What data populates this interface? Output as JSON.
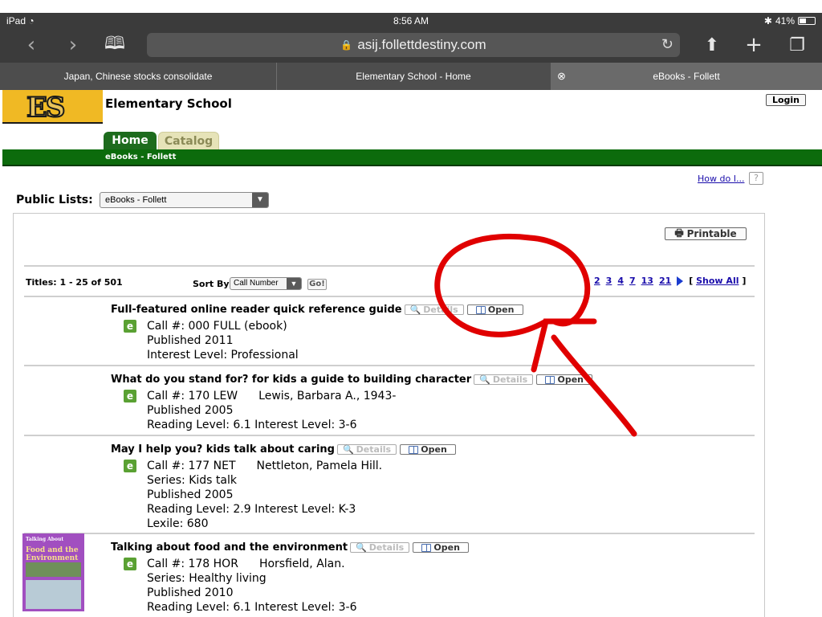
{
  "status": {
    "device": "iPad",
    "time": "8:56 AM",
    "battery": "41%"
  },
  "browser": {
    "url": "asij.follettdestiny.com"
  },
  "tabs": [
    {
      "label": "Japan, Chinese stocks consolidate"
    },
    {
      "label": "Elementary School - Home"
    },
    {
      "label": "eBooks - Follett"
    }
  ],
  "site": {
    "logo_text": "ES",
    "title": "Elementary School",
    "login_label": "Login"
  },
  "nav": {
    "home": "Home",
    "catalog": "Catalog",
    "breadcrumb": "eBooks - Follett"
  },
  "help": {
    "how_do_i": "How do I...",
    "help_icon": "?"
  },
  "lists": {
    "label": "Public Lists:",
    "selected": "eBooks - Follett"
  },
  "toolbar": {
    "printable": "Printable"
  },
  "results": {
    "count": "Titles: 1 - 25 of 501",
    "sort_label": "Sort By",
    "sort_selected": "Call Number",
    "go": "Go!",
    "pages": [
      "2",
      "3",
      "4",
      "7",
      "13",
      "21"
    ],
    "show_all": "Show All",
    "show_all_open": "[",
    "show_all_close": "]"
  },
  "buttons": {
    "details": "Details",
    "open": "Open"
  },
  "records": [
    {
      "title": "Full-featured online reader quick reference guide",
      "call": "Call #: 000 FULL (ebook)",
      "lines": [
        "Published 2011",
        "Interest Level: Professional"
      ]
    },
    {
      "title": "What do you stand for? for kids a guide to building character",
      "call": "Call #: 170 LEW",
      "author": "Lewis, Barbara A., 1943-",
      "lines": [
        "Published 2005",
        "Reading Level: 6.1  Interest Level: 3-6"
      ]
    },
    {
      "title": "May I help you? kids talk about caring",
      "call": "Call #: 177 NET",
      "author": "Nettleton, Pamela Hill.",
      "lines": [
        "Series: Kids talk",
        "Published 2005",
        "Reading Level: 2.9  Interest Level: K-3",
        "Lexile: 680"
      ]
    },
    {
      "title": "Talking about food and the environment",
      "call": "Call #: 178 HOR",
      "author": "Horsfield, Alan.",
      "lines": [
        "Series: Healthy living",
        "Published 2010",
        "Reading Level: 6.1  Interest Level: 3-6"
      ],
      "cover": {
        "line1": "Talking About",
        "line2": "Food and the Environment"
      }
    }
  ],
  "icons": {
    "back": "back-chevron-icon",
    "forward": "forward-chevron-icon",
    "bookmarks": "book-icon",
    "lock": "lock-icon",
    "reload": "reload-icon",
    "share": "share-icon",
    "new_tab": "plus-icon",
    "tabs": "tabs-icon",
    "close_tab": "close-circle-icon",
    "ebook": "ebook-icon",
    "details": "magnifier-icon",
    "open": "book-icon",
    "printer": "printer-icon",
    "next": "next-arrow-icon"
  },
  "colors": {
    "brand_green": "#0c6b0c",
    "logo_gold": "#f0b924",
    "link": "#1a0dab",
    "annotation": "#e00000"
  }
}
